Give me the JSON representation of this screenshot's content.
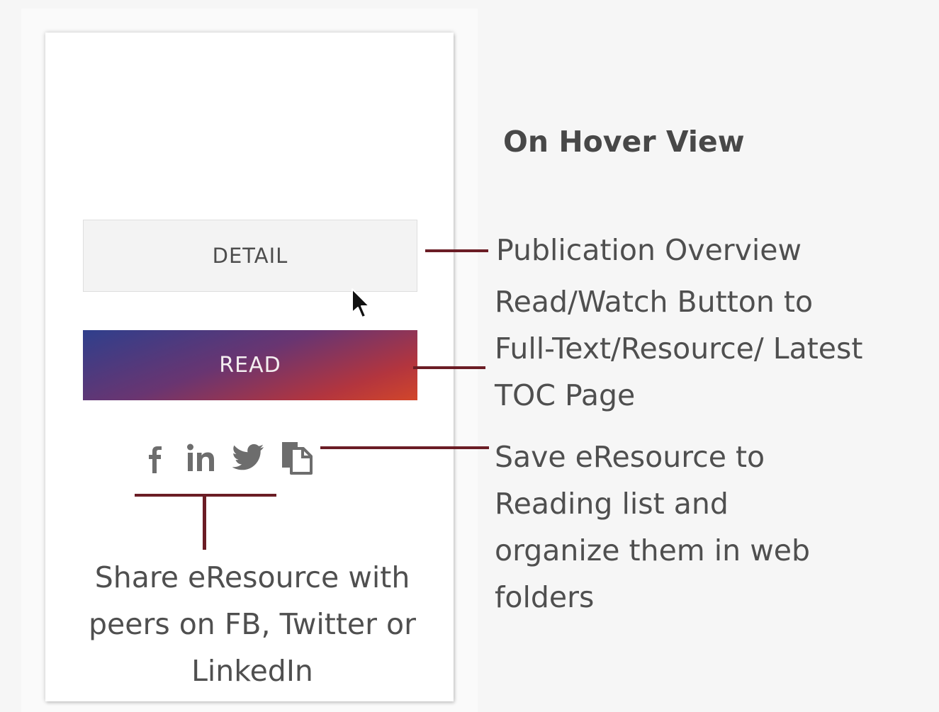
{
  "heading": "On Hover View",
  "buttons": {
    "detail": "DETAIL",
    "read": "READ"
  },
  "social": {
    "icons": [
      "facebook-icon",
      "linkedin-icon",
      "twitter-icon",
      "save-to-list-icon"
    ]
  },
  "annotations": {
    "publication_overview": "Publication Overview",
    "read_button": [
      "Read/Watch Button to",
      "Full-Text/Resource/ Latest",
      "TOC  Page"
    ],
    "save_resource": [
      "Save eResource to",
      "Reading list and",
      "organize them in web",
      "folders"
    ],
    "share_resource": [
      "Share eResource with",
      "peers on FB, Twitter or",
      "LinkedIn"
    ]
  },
  "colors": {
    "connector": "#6b1d25",
    "read_gradient_start": "#2f3f8c",
    "read_gradient_end": "#d2462a",
    "detail_bg": "#f3f3f3"
  }
}
